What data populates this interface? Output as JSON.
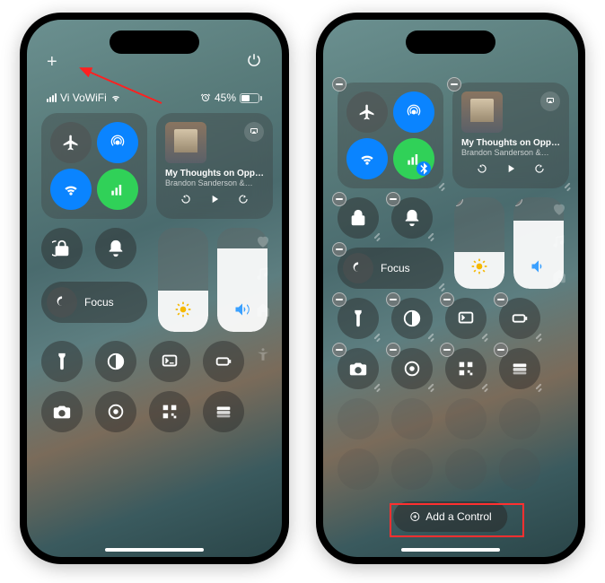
{
  "left": {
    "plus_glyph": "+",
    "carrier": "Vi VoWiFi",
    "battery_text": "45%",
    "battery_fill_pct": 45,
    "alarm_on": true,
    "media": {
      "title": "My Thoughts on Opp…",
      "subtitle": "Brandon Sanderson &…"
    },
    "focus_label": "Focus",
    "brightness_pct": 40,
    "volume_pct": 80
  },
  "right": {
    "media": {
      "title": "My Thoughts on Opp…",
      "subtitle": "Brandon Sanderson &…"
    },
    "focus_label": "Focus",
    "brightness_pct": 40,
    "volume_pct": 75,
    "add_control_label": "Add a Control"
  }
}
